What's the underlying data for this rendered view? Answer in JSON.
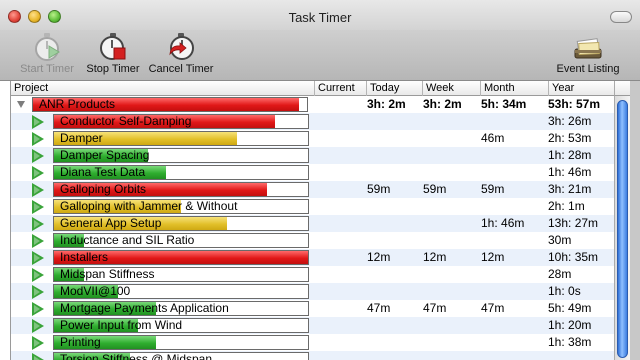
{
  "window": {
    "title": "Task Timer"
  },
  "toolbar": {
    "start": "Start Timer",
    "stop": "Stop Timer",
    "cancel": "Cancel Timer",
    "events": "Event Listing"
  },
  "columns": {
    "project": "Project",
    "current": "Current",
    "today": "Today",
    "week": "Week",
    "month": "Month",
    "year": "Year"
  },
  "colors": {
    "red": "#e11818",
    "yellow": "#e2c02a",
    "green": "#2fae2f",
    "row_alt": "#eaf1fb"
  },
  "rows": [
    {
      "name": "ANR Products",
      "group": true,
      "color": "red",
      "fill": 0.97,
      "current": "",
      "today": "3h: 2m",
      "week": "3h: 2m",
      "month": "5h: 34m",
      "year": "53h: 57m"
    },
    {
      "name": "Conductor Self-Damping",
      "color": "red",
      "fill": 0.87,
      "current": "",
      "today": "",
      "week": "",
      "month": "",
      "year": "3h: 26m"
    },
    {
      "name": "Damper",
      "color": "yellow",
      "fill": 0.72,
      "current": "",
      "today": "",
      "week": "",
      "month": "46m",
      "year": "2h: 53m"
    },
    {
      "name": "Damper Spacing",
      "color": "green",
      "fill": 0.37,
      "current": "",
      "today": "",
      "week": "",
      "month": "",
      "year": "1h: 28m"
    },
    {
      "name": "Diana Test Data",
      "color": "green",
      "fill": 0.44,
      "current": "",
      "today": "",
      "week": "",
      "month": "",
      "year": "1h: 46m"
    },
    {
      "name": "Galloping Orbits",
      "color": "red",
      "fill": 0.84,
      "current": "",
      "today": "59m",
      "week": "59m",
      "month": "59m",
      "year": "3h: 21m"
    },
    {
      "name": "Galloping with Jammer & Without",
      "color": "yellow",
      "fill": 0.5,
      "current": "",
      "today": "",
      "week": "",
      "month": "",
      "year": "2h: 1m"
    },
    {
      "name": "General App Setup",
      "color": "yellow",
      "fill": 0.68,
      "current": "",
      "today": "",
      "week": "",
      "month": "1h: 46m",
      "year": "13h: 27m"
    },
    {
      "name": "Inductance and SIL Ratio",
      "color": "green",
      "fill": 0.12,
      "current": "",
      "today": "",
      "week": "",
      "month": "",
      "year": "30m"
    },
    {
      "name": "Installers",
      "color": "red",
      "fill": 1.0,
      "current": "",
      "today": "12m",
      "week": "12m",
      "month": "12m",
      "year": "10h: 35m"
    },
    {
      "name": "Midspan Stiffness",
      "color": "green",
      "fill": 0.12,
      "current": "",
      "today": "",
      "week": "",
      "month": "",
      "year": "28m"
    },
    {
      "name": "ModVII@100",
      "color": "green",
      "fill": 0.25,
      "current": "",
      "today": "",
      "week": "",
      "month": "",
      "year": "1h: 0s"
    },
    {
      "name": "Mortgage Payments Application",
      "color": "green",
      "fill": 0.4,
      "current": "",
      "today": "47m",
      "week": "47m",
      "month": "47m",
      "year": "5h: 49m"
    },
    {
      "name": "Power Input from Wind",
      "color": "green",
      "fill": 0.33,
      "current": "",
      "today": "",
      "week": "",
      "month": "",
      "year": "1h: 20m"
    },
    {
      "name": "Printing",
      "color": "green",
      "fill": 0.4,
      "current": "",
      "today": "",
      "week": "",
      "month": "",
      "year": "1h: 38m"
    },
    {
      "name": "Torsion Stiffness @ Midspan",
      "color": "green",
      "fill": 0.3,
      "current": "",
      "today": "",
      "week": "",
      "month": "",
      "year": ""
    }
  ]
}
